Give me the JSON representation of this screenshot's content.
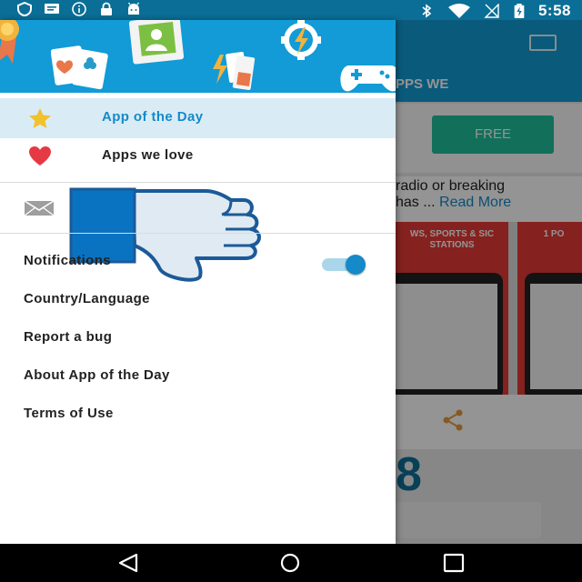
{
  "status_bar": {
    "time": "5:58",
    "left_icons": [
      "shield-icon",
      "message-icon",
      "info-icon",
      "lock-icon",
      "android-icon"
    ],
    "right_icons": [
      "bluetooth-icon",
      "wifi-icon",
      "no-signal-icon",
      "battery-charging-icon"
    ]
  },
  "drawer": {
    "items": [
      {
        "label": "App of the Day",
        "icon": "star-icon",
        "active": true
      },
      {
        "label": "Apps we love",
        "icon": "heart-icon",
        "active": false
      }
    ],
    "settings": {
      "notifications": "Notifications",
      "notifications_on": true,
      "country_language": "Country/Language",
      "report_bug": "Report a bug",
      "about": "About App of the Day",
      "terms": "Terms of Use"
    }
  },
  "background_app": {
    "tab_text": "PPS WE",
    "free_button": "FREE",
    "description_line1": "radio or breaking",
    "description_line2": "has ... ",
    "read_more": "Read More",
    "screenshot_caption_1": "WS, SPORTS & SIC STATIONS",
    "screenshot_caption_2": "1 PO",
    "big_number": "8"
  },
  "colors": {
    "accent": "#129bd6",
    "active_text": "#1689c9",
    "free_button": "#1fbf9b"
  }
}
